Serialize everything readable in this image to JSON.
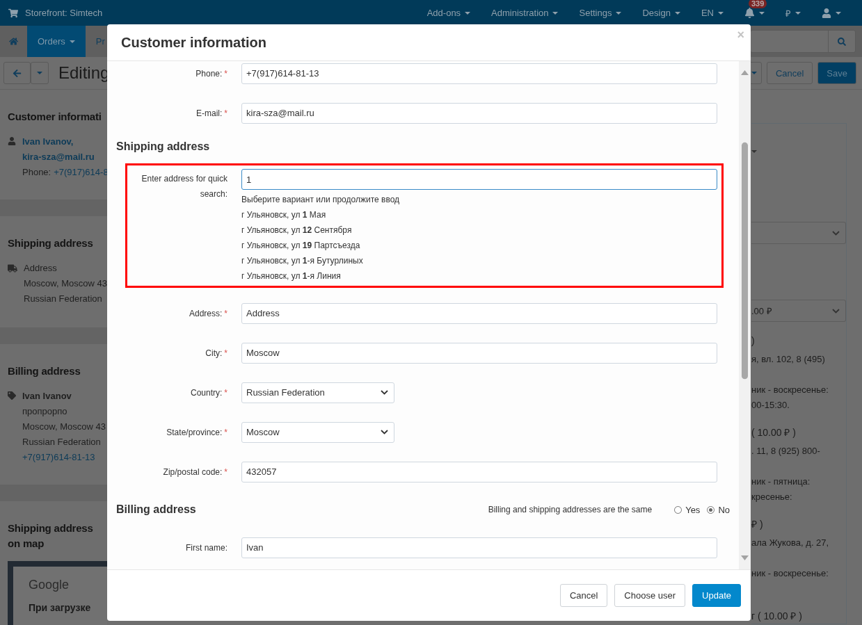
{
  "top_nav": {
    "store": "Storefront: Simtech",
    "menus": [
      {
        "label": "Add-ons"
      },
      {
        "label": "Administration"
      },
      {
        "label": "Settings"
      },
      {
        "label": "Design"
      },
      {
        "label": "EN"
      }
    ],
    "notifications": "339",
    "currency": "₽"
  },
  "sub_nav": {
    "tabs": [
      {
        "kind": "home",
        "selected": false
      },
      {
        "kind": "text",
        "label": "Orders",
        "selected": true
      },
      {
        "kind": "text",
        "label": "Pr",
        "selected": false
      }
    ]
  },
  "toolbar": {
    "title": "Editing",
    "buttons": [
      {
        "kind": "default",
        "label": "Cancel"
      },
      {
        "kind": "primary",
        "label": "Save"
      }
    ]
  },
  "sidebar": {
    "sections": [
      {
        "kind": "customer",
        "title": "Customer informati",
        "name": "Ivan Ivanov,",
        "email": "kira-sza@mail.ru",
        "phone_label": "Phone:",
        "phone": "+7(917)614-8"
      },
      {
        "kind": "shipping",
        "title": "Shipping address",
        "lines": [
          "Address",
          "Moscow, Moscow 43",
          "Russian Federation"
        ]
      },
      {
        "kind": "billing",
        "title": "Billing address",
        "name": "Ivan Ivanov",
        "lines": [
          "пропрорпо",
          "Moscow, Moscow 43",
          "Russian Federation"
        ],
        "phone": "+7(917)614-81-13"
      },
      {
        "kind": "map",
        "title": "Shipping address on map",
        "map_logo": "Google",
        "map_text": "При загрузке"
      }
    ]
  },
  "right_panel": {
    "select_value": ".00 ₽",
    "options": [
      {
        "title": ")",
        "address": "я, вл. 102, 8 (495)",
        "hours": [
          "ник - воскресенье:",
          "00-15:30."
        ]
      },
      {
        "title": "( 10.00 ₽ )",
        "address": ". 11, 8 (925) 800-",
        "hours": [
          "ник - пятница:",
          "кресенье:"
        ]
      },
      {
        "title": "₽ )",
        "address": "ала Жукова, д. 27,",
        "hours": [
          "ник - воскресенье:"
        ]
      },
      {
        "title": "г ( 10.00 ₽ )"
      }
    ]
  },
  "modal": {
    "title": "Customer information",
    "close": "×",
    "fields": [
      {
        "kind": "input",
        "label": "Phone:",
        "mark": "*",
        "value": "+7(917)614-81-13"
      },
      {
        "kind": "input",
        "label": "E-mail:",
        "mark": "*",
        "value": "kira-sza@mail.ru"
      },
      {
        "kind": "heading",
        "label": "Shipping address"
      },
      {
        "kind": "quick_search",
        "label": "Enter address for quick search:",
        "value": "1",
        "hint": "Выберите вариант или продолжите ввод",
        "suggestions": [
          "г Ульяновск, ул **1** Мая",
          "г Ульяновск, ул **12** Сентября",
          "г Ульяновск, ул **19** Партсъезда",
          "г Ульяновск, ул **1**-я Бутурлиных",
          "г Ульяновск, ул **1**-я Линия"
        ]
      },
      {
        "kind": "input",
        "label": "Address:",
        "mark": "*",
        "value": "Address"
      },
      {
        "kind": "input",
        "label": "City:",
        "mark": "*",
        "value": "Moscow"
      },
      {
        "kind": "select",
        "label": "Country:",
        "mark": "*",
        "value": "Russian Federation"
      },
      {
        "kind": "select",
        "label": "State/province:",
        "mark": "*",
        "value": "Moscow"
      },
      {
        "kind": "input",
        "label": "Zip/postal code:",
        "mark": "*",
        "value": "432057"
      },
      {
        "kind": "heading",
        "label": "Billing address",
        "same_label": "Billing and shipping addresses are the same",
        "options": [
          {
            "label": "Yes",
            "selected": false
          },
          {
            "label": "No",
            "selected": true
          }
        ]
      },
      {
        "kind": "input",
        "label": "First name:",
        "value": "Ivan"
      }
    ],
    "buttons": [
      {
        "kind": "default",
        "label": "Cancel"
      },
      {
        "kind": "default",
        "label": "Choose user"
      },
      {
        "kind": "primary",
        "label": "Update"
      }
    ]
  }
}
